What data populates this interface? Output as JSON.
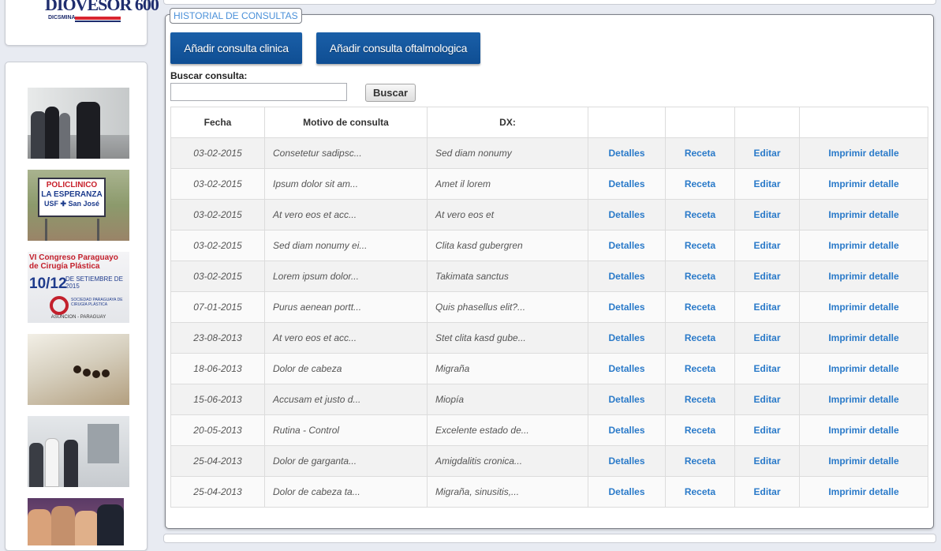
{
  "sidebar": {
    "logo": {
      "main_text": "DIOVESOR 600",
      "sub_text": "DICSMINA"
    },
    "thumbs": [
      {
        "name": "photo-visit"
      },
      {
        "name": "photo-policlinico",
        "lines": [
          "POLICLINICO",
          "LA ESPERANZA",
          "USF ✚ San José"
        ]
      },
      {
        "name": "photo-congreso",
        "title": "VI Congreso Paraguayo de Cirugía Plástica",
        "dates": "10/12",
        "month": "DE SETIEMBRE DE 2015",
        "society": "SOCIEDAD PARAGUAYA DE CIRUGÍA PLÁSTICA",
        "place": "ASUNCION - PARAGUAY"
      },
      {
        "name": "photo-needles"
      },
      {
        "name": "photo-xray-room"
      },
      {
        "name": "photo-group"
      }
    ]
  },
  "panel": {
    "legend": "HISTORIAL DE CONSULTAS",
    "buttons": {
      "add_clinical": "Añadir consulta clinica",
      "add_ophthalmo": "Añadir consulta oftalmologica"
    },
    "search": {
      "label": "Buscar consulta:",
      "value": "",
      "button": "Buscar"
    }
  },
  "table": {
    "headers": [
      "Fecha",
      "Motivo de consulta",
      "DX:",
      "",
      "",
      "",
      ""
    ],
    "actions": [
      "Detalles",
      "Receta",
      "Editar",
      "Imprimir detalle"
    ],
    "rows": [
      {
        "fecha": "03-02-2015",
        "motivo": "Consetetur sadipsc...",
        "dx": "Sed diam nonumy"
      },
      {
        "fecha": "03-02-2015",
        "motivo": "Ipsum dolor sit am...",
        "dx": "Amet il lorem"
      },
      {
        "fecha": "03-02-2015",
        "motivo": "At vero eos et acc...",
        "dx": "At vero eos et"
      },
      {
        "fecha": "03-02-2015",
        "motivo": "Sed diam nonumy ei...",
        "dx": "Clita kasd gubergren"
      },
      {
        "fecha": "03-02-2015",
        "motivo": "Lorem ipsum dolor...",
        "dx": "Takimata sanctus"
      },
      {
        "fecha": "07-01-2015",
        "motivo": "Purus aenean portt...",
        "dx": "Quis phasellus elit?..."
      },
      {
        "fecha": "23-08-2013",
        "motivo": "At vero eos et acc...",
        "dx": "Stet clita kasd gube..."
      },
      {
        "fecha": "18-06-2013",
        "motivo": "Dolor de cabeza",
        "dx": "Migraña"
      },
      {
        "fecha": "15-06-2013",
        "motivo": "Accusam et justo d...",
        "dx": "Miopía"
      },
      {
        "fecha": "20-05-2013",
        "motivo": "Rutina - Control",
        "dx": "Excelente estado de..."
      },
      {
        "fecha": "25-04-2013",
        "motivo": "Dolor de garganta...",
        "dx": "Amigdalitis cronica..."
      },
      {
        "fecha": "25-04-2013",
        "motivo": "Dolor de cabeza ta...",
        "dx": "Migraña, sinusitis,..."
      }
    ]
  },
  "colors": {
    "accent_blue": "#0f4e93",
    "link_blue": "#2a7ac9",
    "legend_blue": "#4a90d9"
  }
}
